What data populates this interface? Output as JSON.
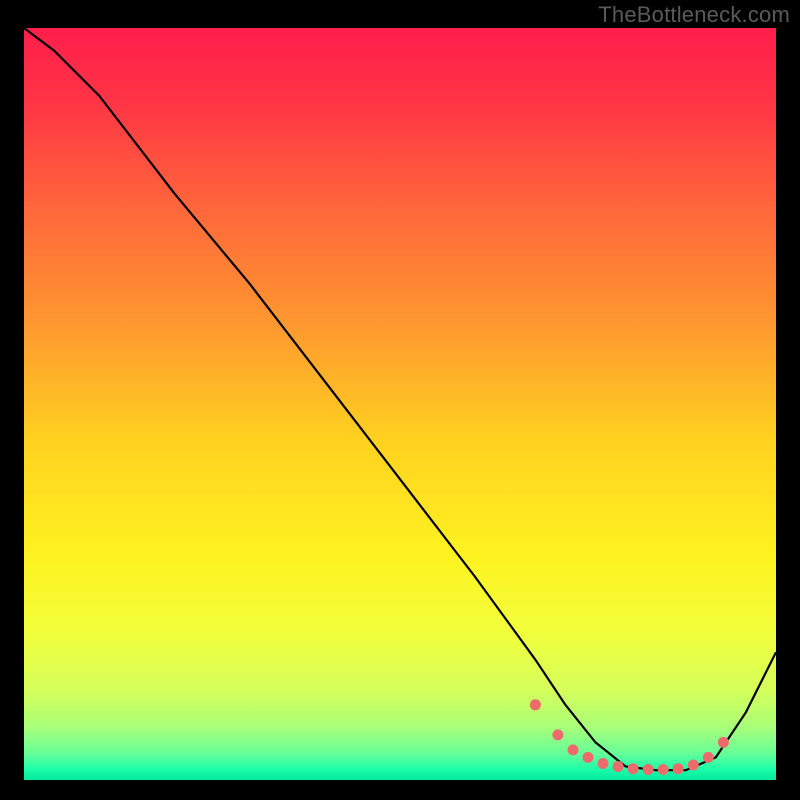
{
  "watermark": "TheBottleneck.com",
  "chart_data": {
    "type": "line",
    "title": "",
    "xlabel": "",
    "ylabel": "",
    "xlim": [
      0,
      100
    ],
    "ylim": [
      0,
      100
    ],
    "grid": false,
    "series": [
      {
        "name": "curve",
        "x": [
          0,
          4,
          10,
          20,
          30,
          40,
          50,
          60,
          68,
          72,
          76,
          80,
          84,
          88,
          92,
          96,
          100
        ],
        "values": [
          100,
          97,
          91,
          78,
          66,
          53,
          40,
          27,
          16,
          10,
          5,
          1.8,
          1.3,
          1.3,
          3,
          9,
          17
        ]
      }
    ],
    "markers": {
      "name": "dots",
      "x": [
        68,
        71,
        73,
        75,
        77,
        79,
        81,
        83,
        85,
        87,
        89,
        91,
        93
      ],
      "values": [
        10,
        6,
        4,
        3,
        2.2,
        1.8,
        1.5,
        1.4,
        1.4,
        1.5,
        2,
        3,
        5
      ]
    },
    "gradient_stops": [
      {
        "offset": 0.0,
        "color": "#ff1e4b"
      },
      {
        "offset": 0.1,
        "color": "#ff3545"
      },
      {
        "offset": 0.25,
        "color": "#ff6a3a"
      },
      {
        "offset": 0.4,
        "color": "#ff9a2f"
      },
      {
        "offset": 0.55,
        "color": "#ffd21f"
      },
      {
        "offset": 0.7,
        "color": "#fff220"
      },
      {
        "offset": 0.8,
        "color": "#f2ff3a"
      },
      {
        "offset": 0.88,
        "color": "#d6ff5a"
      },
      {
        "offset": 0.93,
        "color": "#a8ff78"
      },
      {
        "offset": 0.965,
        "color": "#66ff99"
      },
      {
        "offset": 0.985,
        "color": "#1effa8"
      },
      {
        "offset": 1.0,
        "color": "#00e8a0"
      }
    ],
    "line_color": "#000000",
    "marker_color": "#ef6b6b"
  }
}
